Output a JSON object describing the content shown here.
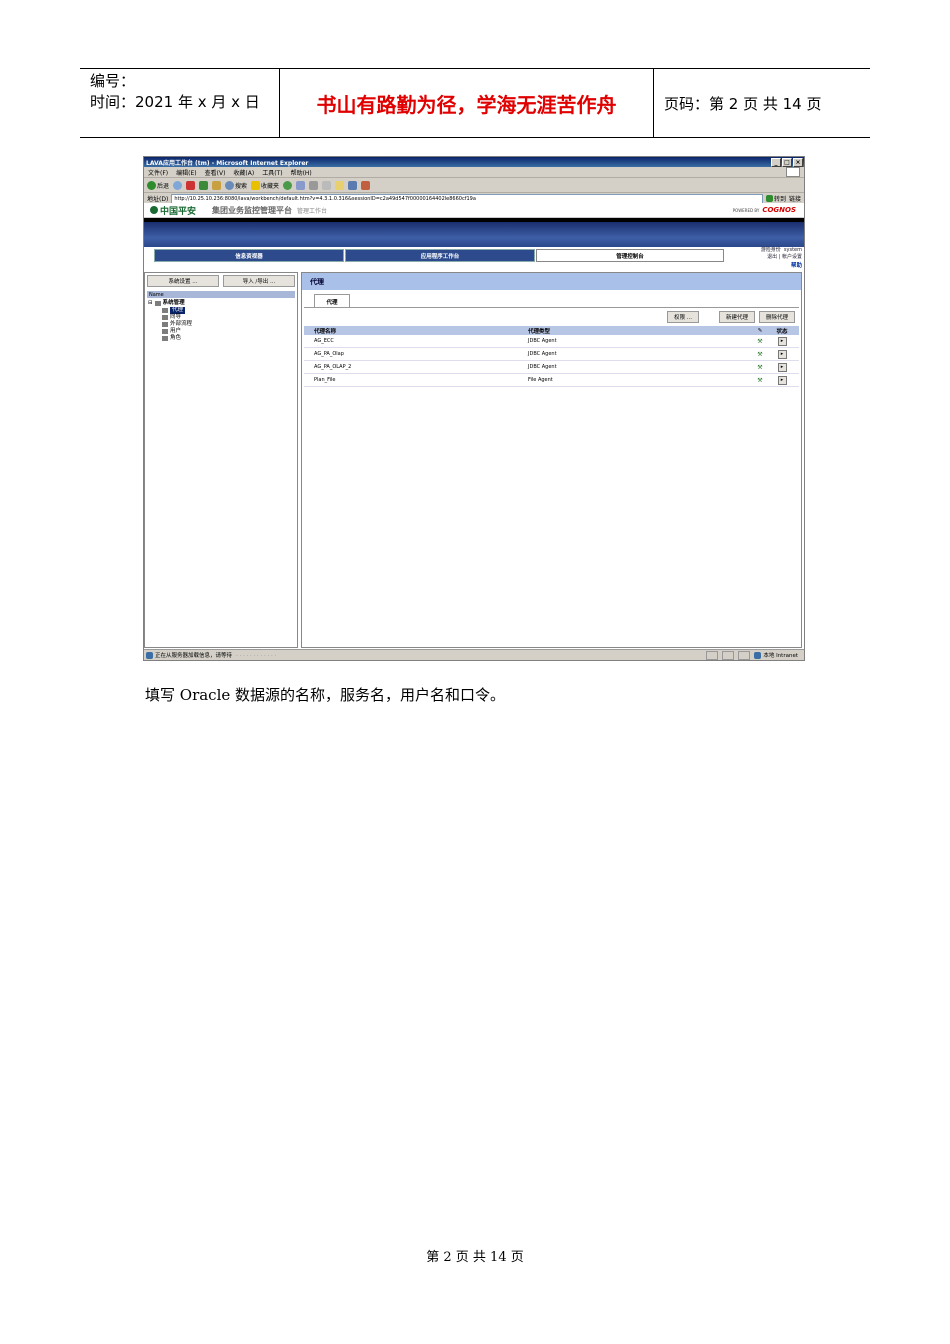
{
  "header": {
    "number_label": "编号：",
    "time_label": "时间：2021 年 x 月 x 日",
    "motto": "书山有路勤为径，学海无涯苦作舟",
    "page_label": "页码：第 2 页  共 14 页"
  },
  "window": {
    "title": "LAVA应用工作台 (tm) - Microsoft Internet Explorer",
    "controls": [
      "_",
      "□",
      "×"
    ],
    "menu": [
      "文件(F)",
      "编辑(E)",
      "查看(V)",
      "收藏(A)",
      "工具(T)",
      "帮助(H)"
    ],
    "toolbar": {
      "back": "后退",
      "search": "搜索",
      "favorites": "收藏夹"
    },
    "address_label": "地址(D)",
    "address_value": "http://10.25.10.236:8080/lava/workbench/default.htm?v=4.3.1.0.316&sessionID=c2a49d547f00000164402le8660cf19a",
    "go_label": "转到",
    "links_label": "链接"
  },
  "app": {
    "brand": "中国平安",
    "platform_title": "集团业务监控管理平台",
    "workbench_label": "管理工作台",
    "powered_by": "POWERED BY",
    "vendor": "COGNOS",
    "tabs": [
      "信息资视器",
      "应用程序工作台",
      "管理控制台"
    ],
    "active_tab": 2,
    "user_links": [
      "游险身份",
      "system",
      "退出",
      "帐户设置"
    ],
    "help": "帮助",
    "left": {
      "buttons": [
        "系统设置 ...",
        "导入 /导出 ..."
      ],
      "column": "Name",
      "tree_root": "系统管理",
      "tree_items": [
        "代理",
        "向导",
        "外部流程",
        "用户",
        "角色"
      ]
    },
    "panel": {
      "title": "代理",
      "subtab": "代理",
      "actions": [
        "权限 ...",
        "新建代理",
        "删除代理"
      ],
      "columns": [
        "代理名称",
        "代理类型",
        "状态"
      ],
      "rows": [
        {
          "name": "AG_ECC",
          "type": "JDBC Agent"
        },
        {
          "name": "AG_PA_Olap",
          "type": "JDBC Agent"
        },
        {
          "name": "AG_PA_OLAP_2",
          "type": "JDBC Agent"
        },
        {
          "name": "Plan_File",
          "type": "File Agent"
        }
      ]
    },
    "status": "正在从服务器加载信息，请等待",
    "status_dots": ". . . . . . . . . . . .",
    "zone": "本地 Intranet"
  },
  "caption": "填写 Oracle 数据源的名称，服务名，用户名和口令。",
  "footer": "第  2  页  共  14  页"
}
